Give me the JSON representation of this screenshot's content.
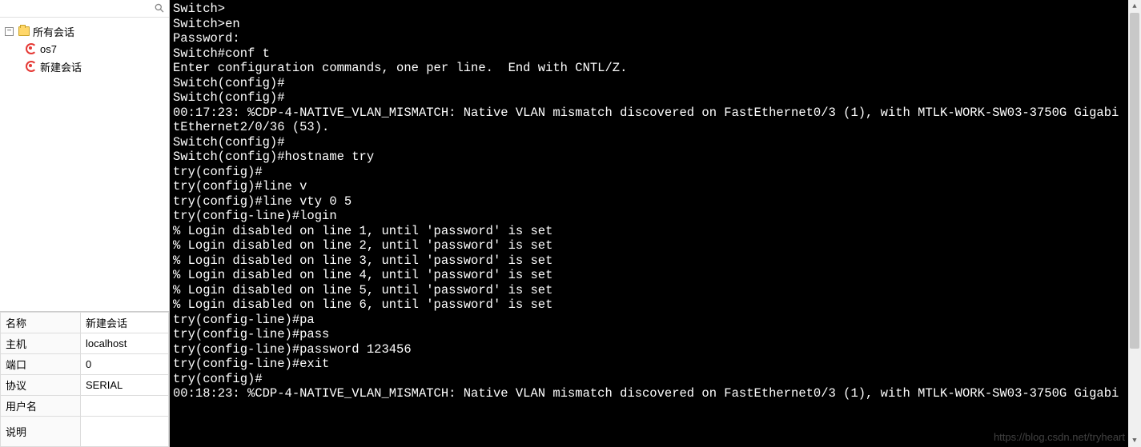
{
  "sidebar": {
    "root_label": "所有会话",
    "items": [
      {
        "label": "os7"
      },
      {
        "label": "新建会话"
      }
    ]
  },
  "props": {
    "rows": [
      {
        "k": "名称",
        "v": "新建会话"
      },
      {
        "k": "主机",
        "v": "localhost"
      },
      {
        "k": "端口",
        "v": "0"
      },
      {
        "k": "协议",
        "v": "SERIAL"
      },
      {
        "k": "用户名",
        "v": ""
      },
      {
        "k": "说明",
        "v": ""
      }
    ]
  },
  "terminal": {
    "lines": [
      "Switch>",
      "Switch>en",
      "Password:",
      "Switch#conf t",
      "Enter configuration commands, one per line.  End with CNTL/Z.",
      "Switch(config)#",
      "Switch(config)#",
      "00:17:23: %CDP-4-NATIVE_VLAN_MISMATCH: Native VLAN mismatch discovered on FastEthernet0/3 (1), with MTLK-WORK-SW03-3750G Gigabi",
      "tEthernet2/0/36 (53).",
      "Switch(config)#",
      "Switch(config)#hostname try",
      "try(config)#",
      "try(config)#line v",
      "try(config)#line vty 0 5",
      "try(config-line)#login",
      "% Login disabled on line 1, until 'password' is set",
      "% Login disabled on line 2, until 'password' is set",
      "% Login disabled on line 3, until 'password' is set",
      "% Login disabled on line 4, until 'password' is set",
      "% Login disabled on line 5, until 'password' is set",
      "% Login disabled on line 6, until 'password' is set",
      "try(config-line)#pa",
      "try(config-line)#pass",
      "try(config-line)#password 123456",
      "try(config-line)#exit",
      "try(config)#",
      "00:18:23: %CDP-4-NATIVE_VLAN_MISMATCH: Native VLAN mismatch discovered on FastEthernet0/3 (1), with MTLK-WORK-SW03-3750G Gigabi"
    ]
  },
  "watermark": "https://blog.csdn.net/tryheart"
}
